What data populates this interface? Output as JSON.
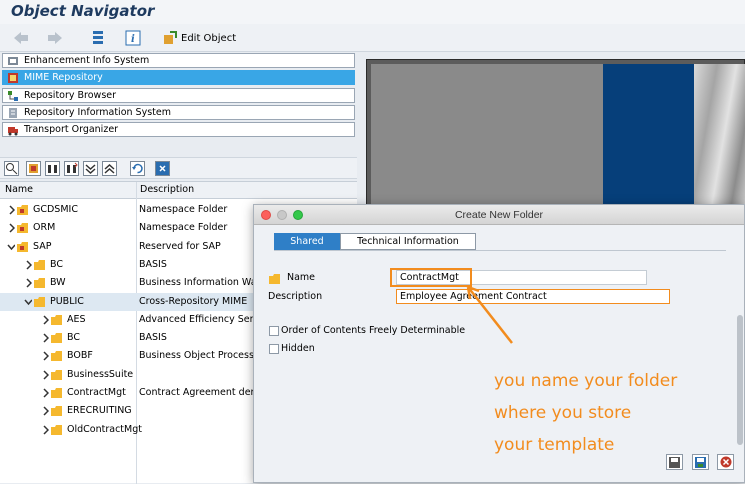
{
  "app": {
    "title": "Object Navigator"
  },
  "toolbar": {
    "back": "back",
    "forward": "forward",
    "edit_object": "Edit Object"
  },
  "nav": {
    "items": [
      {
        "label": "Enhancement Info System",
        "icon": "enhancement-icon"
      },
      {
        "label": "MIME Repository",
        "icon": "mime-icon",
        "selected": true
      },
      {
        "label": "Repository Browser",
        "icon": "repository-browser-icon"
      },
      {
        "label": "Repository Information System",
        "icon": "info-system-icon"
      },
      {
        "label": "Transport Organizer",
        "icon": "transport-icon"
      }
    ]
  },
  "tree": {
    "columns": {
      "name": "Name",
      "description": "Description"
    },
    "rows": [
      {
        "name": "GCDSMIC",
        "description": "Namespace Folder"
      },
      {
        "name": "ORM",
        "description": "Namespace Folder"
      },
      {
        "name": "SAP",
        "description": "Reserved for SAP"
      },
      {
        "name": "BC",
        "description": "BASIS"
      },
      {
        "name": "BW",
        "description": "Business Information Wa"
      },
      {
        "name": "PUBLIC",
        "description": "Cross-Repository MIME"
      },
      {
        "name": "AES",
        "description": "Advanced Efficiency Serv"
      },
      {
        "name": "BC",
        "description": "BASIS"
      },
      {
        "name": "BOBF",
        "description": "Business Object Process"
      },
      {
        "name": "BusinessSuite",
        "description": ""
      },
      {
        "name": "ContractMgt",
        "description": "Contract Agreement der"
      },
      {
        "name": "ERECRUITING",
        "description": ""
      },
      {
        "name": "OldContractMgt",
        "description": ""
      }
    ]
  },
  "dialog": {
    "title": "Create New Folder",
    "tabs": {
      "shared": "Shared",
      "technical": "Technical Information"
    },
    "name_label": "Name",
    "name_value": "ContractMgt",
    "description_label": "Description",
    "description_value": "Employee Agreement Contract",
    "option_order": "Order of Contents Freely Determinable",
    "option_hidden": "Hidden"
  },
  "annotation": {
    "line1": "you name your folder",
    "line2": "where you store",
    "line3": "your template"
  },
  "colors": {
    "accent": "#39a6e6",
    "callout": "#f28c1e",
    "tab_active": "#2f7fc7"
  }
}
